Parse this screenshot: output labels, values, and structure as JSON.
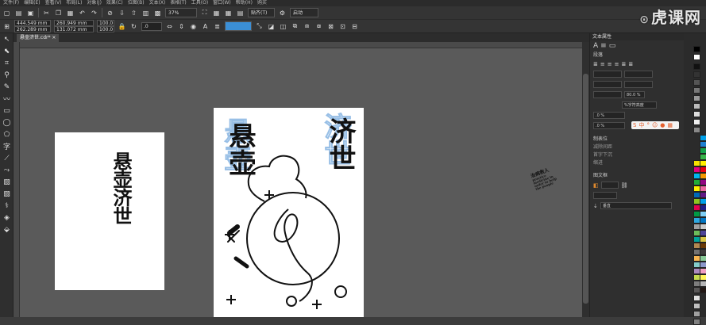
{
  "menu": [
    "文件(F)",
    "编辑(E)",
    "查看(V)",
    "布局(L)",
    "对象(J)",
    "效果(C)",
    "位图(B)",
    "文本(X)",
    "表格(T)",
    "工具(O)",
    "窗口(W)",
    "帮助(H)",
    "购买"
  ],
  "toolbar": {
    "zoom": "37%",
    "snap_label": "贴齐(T)",
    "launch_label": "启动"
  },
  "propbar": {
    "x": "444.549 mm",
    "y": "262.289 mm",
    "w": "260.949 mm",
    "h": "131.072 mm",
    "scale_x": "100.0",
    "scale_y": "100.0",
    "angle": ".0"
  },
  "document": {
    "tab_name": "悬壶济世.cdr*"
  },
  "canvas": {
    "page1_text": "悬壶济世",
    "page2_left_text": "悬壶",
    "page2_right_text": "济世",
    "stamp_text": "治病救人",
    "stamp_en": "practice medicine in order to help the people"
  },
  "rightpanel": {
    "title": "文本属性",
    "section_paragraph": "段落",
    "spacing_value": "80.0 %",
    "char_spacing_label": "%字符高度",
    "percent_a": ".0 %",
    "percent_b": ".0 %",
    "section_tab": "制表位",
    "tab_items": [
      "减除间距",
      "首字下沉",
      "缩进"
    ],
    "section_frame": "图文框",
    "direction_label": "垂直"
  },
  "watermark": {
    "logo_text": "虎课网"
  },
  "ime": {
    "logo": "S"
  },
  "colors": {
    "accent": "#3b8fd6",
    "ghost_outline": "#7fb0e0",
    "page": "#ffffff",
    "desktop": "#5a5a5a"
  }
}
